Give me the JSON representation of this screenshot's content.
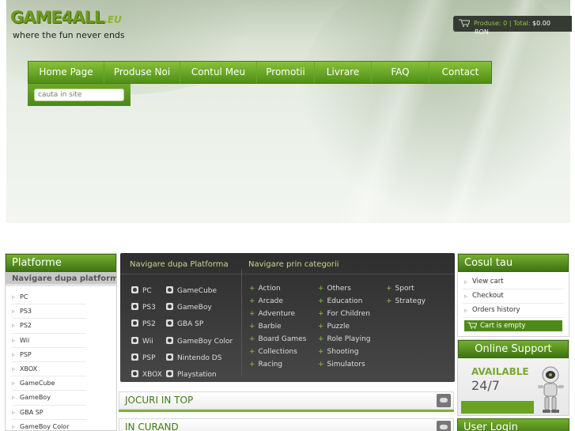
{
  "header": {
    "logo_name": "GAME4ALL",
    "logo_domain": ".EU",
    "tagline": "where the fun never ends"
  },
  "top_cart": {
    "products_label": "Produse:",
    "products_count": "0",
    "separator": "|",
    "total_label": "Total:",
    "total_value": "$0.00",
    "currency": "RON"
  },
  "nav": {
    "items": [
      {
        "label": "Home Page"
      },
      {
        "label": "Produse Noi"
      },
      {
        "label": "Contul Meu"
      },
      {
        "label": "Promotii"
      },
      {
        "label": "Livrare"
      },
      {
        "label": "FAQ"
      },
      {
        "label": "Contact"
      }
    ]
  },
  "search": {
    "placeholder": "cauta in site"
  },
  "left_sidebar": {
    "title": "Platforme",
    "subtitle": "Navigare dupa platforma",
    "items": [
      "PC",
      "PS3",
      "PS2",
      "Wii",
      "PSP",
      "XBOX",
      "GameCube",
      "GameBoy",
      "GBA SP",
      "GameBoy Color"
    ]
  },
  "browse": {
    "platform_title": "Navigare dupa Platforma",
    "category_title": "Navigare prin categorii",
    "platforms_col1": [
      "PC",
      "PS3",
      "PS2",
      "Wii",
      "PSP",
      "XBOX"
    ],
    "platforms_col2": [
      "GameCube",
      "GameBoy",
      "GBA SP",
      "GameBoy Color",
      "Nintendo DS",
      "Playstation"
    ],
    "categories_col1": [
      "Action",
      "Arcade",
      "Adventure",
      "Barbie",
      "Board Games",
      "Collections",
      "Racing"
    ],
    "categories_col2": [
      "Others",
      "Education",
      "For Children",
      "Puzzle",
      "Role Playing",
      "Shooting",
      "Simulators"
    ],
    "categories_col3": [
      "Sport",
      "Strategy"
    ]
  },
  "sections": {
    "top_title": "JOCURI IN TOP",
    "soon_title": "IN CURAND"
  },
  "right_sidebar": {
    "cart_title": "Cosul tau",
    "cart_links": [
      "View cart",
      "Checkout",
      "Orders history"
    ],
    "cart_status": "Cart is empty",
    "support_title": "Online Support",
    "support_status": "AVAILABLE",
    "support_hours": "24/7",
    "login_title": "User Login"
  },
  "colors": {
    "accent_green": "#5a9a1e",
    "dark_panel": "#353535"
  }
}
